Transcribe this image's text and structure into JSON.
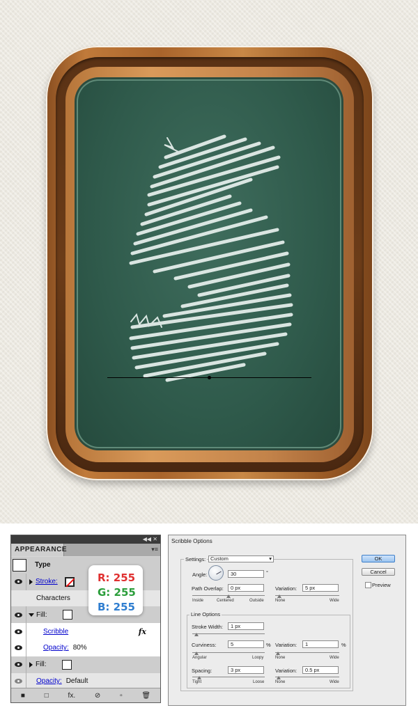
{
  "colors": {
    "rgb_red": "#e03030",
    "rgb_green": "#2a9d3a",
    "rgb_blue": "#2f7ed0",
    "chalk": "#e8f1ee",
    "board": "#2f5a4b",
    "link": "#0000cc"
  },
  "appearance": {
    "title": "APPEARANCE",
    "collapse_icons": "◀◀ ✕",
    "menu_icon": "▾≡",
    "rows": {
      "type": "Type",
      "stroke": "Stroke:",
      "characters": "Characters",
      "fill1": "Fill:",
      "scribble": "Scribble",
      "fx": "fx",
      "opacity1_label": "Opacity:",
      "opacity1_value": "80%",
      "fill2": "Fill:",
      "opacity2_label": "Opacity:",
      "opacity2_value": "Default"
    },
    "bottom_icons": [
      "■",
      "□",
      "fx.",
      "⊘",
      "▫",
      "🗑"
    ]
  },
  "rgb": {
    "r": "R: 255",
    "g": "G: 255",
    "b": "B: 255"
  },
  "scribble": {
    "title": "Scribble Options",
    "settings_label": "Settings:",
    "settings_value": "Custom",
    "angle_label": "Angle:",
    "angle_value": "30",
    "angle_unit": "°",
    "overlap_label": "Path Overlap:",
    "overlap_value": "0 px",
    "overlap_variation_label": "Variation:",
    "overlap_variation_value": "5 px",
    "overlap_scale": [
      "Inside",
      "Centered",
      "Outside"
    ],
    "overlap_var_scale": [
      "None",
      "Wide"
    ],
    "line_options_label": "Line Options",
    "stroke_width_label": "Stroke Width:",
    "stroke_width_value": "1 px",
    "curviness_label": "Curviness:",
    "curviness_value": "5",
    "curviness_unit": "%",
    "curviness_variation_label": "Variation:",
    "curviness_variation_value": "1",
    "curviness_variation_unit": "%",
    "curviness_scale": [
      "Angular",
      "Loopy"
    ],
    "curviness_var_scale": [
      "None",
      "Wide"
    ],
    "spacing_label": "Spacing:",
    "spacing_value": "3 px",
    "spacing_variation_label": "Variation:",
    "spacing_variation_value": "0.5 px",
    "spacing_scale": [
      "Tight",
      "Loose"
    ],
    "spacing_var_scale": [
      "None",
      "Wide"
    ],
    "ok": "OK",
    "cancel": "Cancel",
    "preview": "Preview"
  }
}
